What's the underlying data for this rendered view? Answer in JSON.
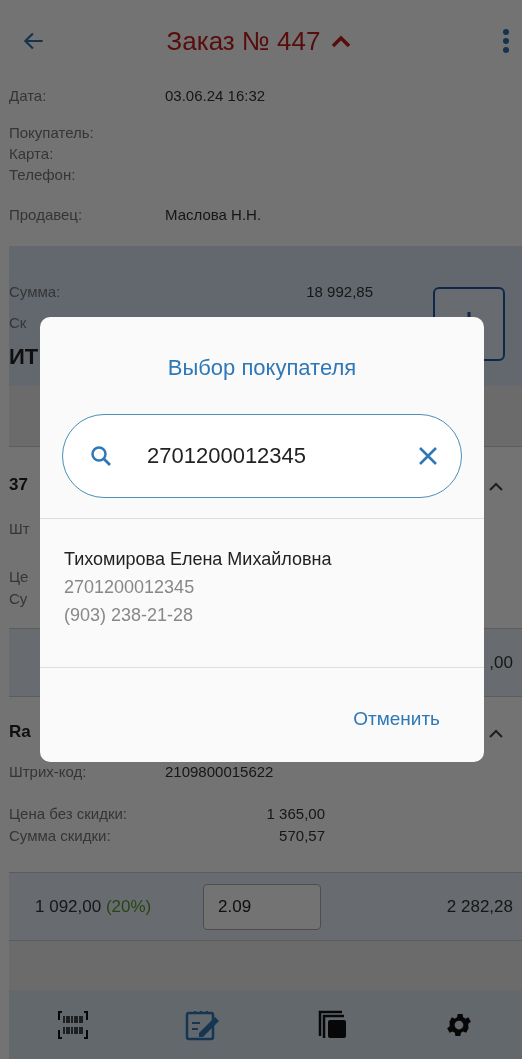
{
  "header": {
    "title": "Заказ № 447"
  },
  "order_info": [
    {
      "label": "Дата:",
      "value": "03.06.24 16:32"
    },
    {
      "label": "Покупатель:"
    },
    {
      "label": "Карта:"
    },
    {
      "label": "Телефон:"
    },
    {
      "label": "Продавец:",
      "value": "Маслова Н.Н."
    }
  ],
  "totals": {
    "rows": [
      {
        "label": "Сумма:",
        "value": "18 992,85"
      },
      {
        "label": "Ск"
      }
    ],
    "total_label": "ИТ"
  },
  "items": [
    {
      "name": "37",
      "expanded": true,
      "details": [
        {
          "label": "Шт"
        },
        {
          "label": "Це"
        },
        {
          "label": "Су"
        }
      ],
      "price_row": {
        "amount": ",00"
      }
    },
    {
      "name": "Ra",
      "expanded": true,
      "details": [
        {
          "label": "Штрих-код:",
          "value": "2109800015622"
        },
        {
          "label": "Цена без скидки:",
          "value": "1 365,00"
        },
        {
          "label": "Сумма скидки:",
          "value": "570,57"
        }
      ],
      "price_row": {
        "price": "1 092,00",
        "discount": "(20%)",
        "quantity": "2.09",
        "amount": "2 282,28"
      }
    }
  ],
  "bottom_nav": [
    {
      "kind": "barcode",
      "selected": false
    },
    {
      "kind": "edit",
      "selected": true
    },
    {
      "kind": "copy",
      "selected": false
    },
    {
      "kind": "settings",
      "selected": false
    }
  ],
  "dialog": {
    "title": "Выбор покупателя",
    "search": {
      "value": "2701200012345"
    },
    "results": [
      {
        "name": "Тихомирова Елена Михайловна",
        "card": "2701200012345",
        "phone": "(903) 238-21-28"
      }
    ],
    "buttons": [
      "Отменить"
    ]
  }
}
